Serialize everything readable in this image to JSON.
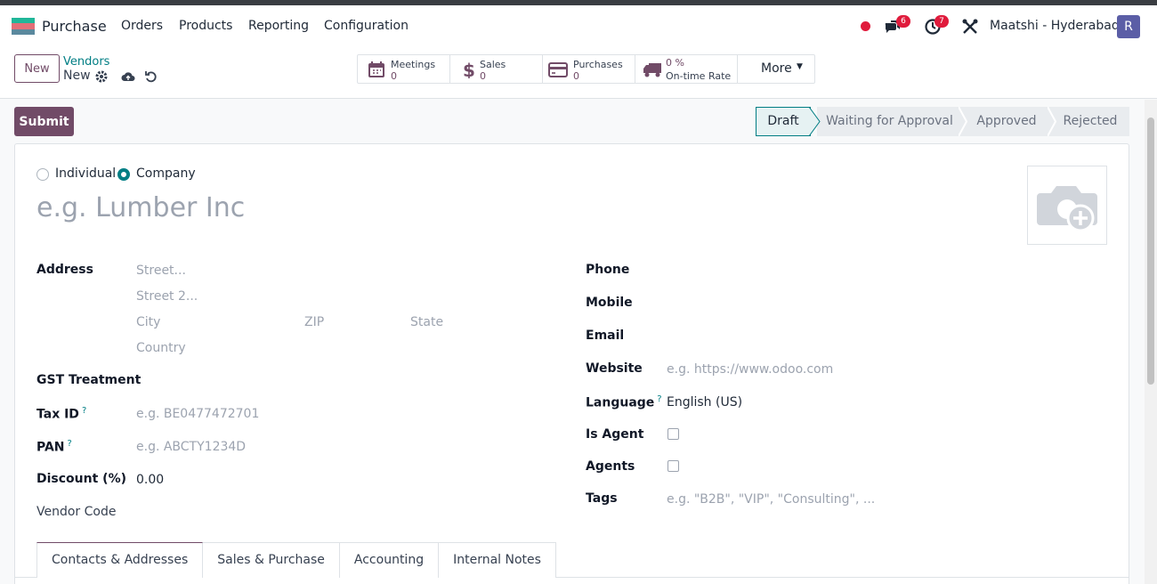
{
  "navbar": {
    "app_name": "Purchase",
    "menu": [
      "Orders",
      "Products",
      "Reporting",
      "Configuration"
    ],
    "messages_count": "6",
    "activities_count": "7",
    "company": "Maatshi - Hyderabad",
    "avatar_initial": "R"
  },
  "control": {
    "new_label": "New",
    "breadcrumb_parent": "Vendors",
    "breadcrumb_current": "New",
    "smart_buttons": [
      {
        "label": "Meetings",
        "value": "0",
        "icon": "calendar-icon"
      },
      {
        "label": "Sales",
        "value": "0",
        "icon": "dollar-icon"
      },
      {
        "label": "Purchases",
        "value": "0",
        "icon": "credit-card-icon"
      },
      {
        "label": "On-time Rate",
        "value": "0 %",
        "icon": "truck-icon"
      }
    ],
    "more_label": "More"
  },
  "status": {
    "submit_label": "Submit",
    "stages": [
      "Draft",
      "Waiting for Approval",
      "Approved",
      "Rejected"
    ],
    "active_stage": "Draft"
  },
  "form": {
    "type_options": [
      "Individual",
      "Company"
    ],
    "selected_type": "Company",
    "name_placeholder": "e.g. Lumber Inc",
    "address_label": "Address",
    "street_placeholder": "Street...",
    "street2_placeholder": "Street 2...",
    "city_placeholder": "City",
    "zip_placeholder": "ZIP",
    "state_placeholder": "State",
    "country_placeholder": "Country",
    "gst_label": "GST Treatment",
    "taxid_label": "Tax ID",
    "taxid_placeholder": "e.g. BE0477472701",
    "pan_label": "PAN",
    "pan_placeholder": "e.g. ABCTY1234D",
    "discount_label": "Discount (%)",
    "discount_value": "0.00",
    "vendor_code_label": "Vendor Code",
    "phone_label": "Phone",
    "mobile_label": "Mobile",
    "email_label": "Email",
    "website_label": "Website",
    "website_placeholder": "e.g. https://www.odoo.com",
    "language_label": "Language",
    "language_value": "English (US)",
    "is_agent_label": "Is Agent",
    "agents_label": "Agents",
    "tags_label": "Tags",
    "tags_placeholder": "e.g. \"B2B\", \"VIP\", \"Consulting\", ...",
    "tooltip_mark": "?"
  },
  "tabs": [
    "Contacts & Addresses",
    "Sales & Purchase",
    "Accounting",
    "Internal Notes"
  ]
}
